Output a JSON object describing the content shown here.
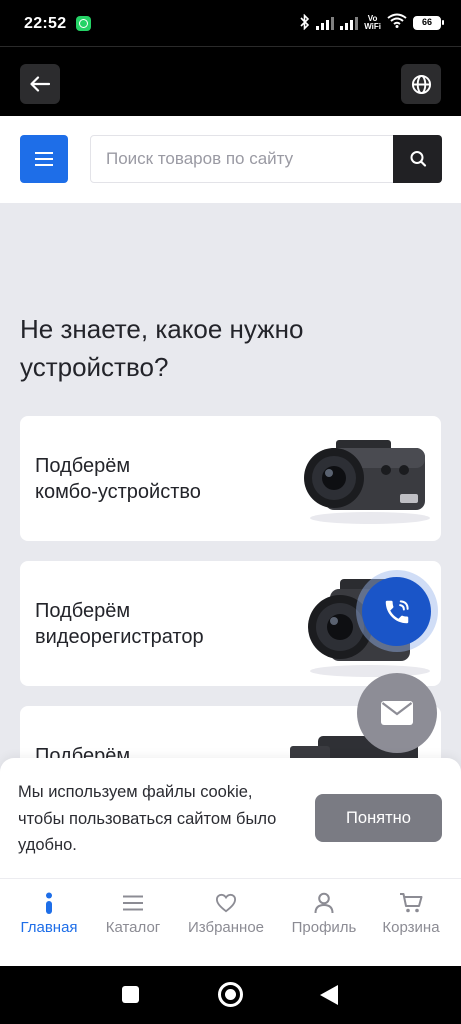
{
  "status_bar": {
    "time": "22:52",
    "network_label_top": "Vo",
    "network_label_bottom": "WiFi",
    "battery": "66"
  },
  "header": {
    "search_placeholder": "Поиск товаров по сайту"
  },
  "main": {
    "title": "Не знаете, какое нужно устройство?",
    "cards": [
      {
        "label_line1": "Подберём",
        "label_line2": "комбо-устройство"
      },
      {
        "label_line1": "Подберём",
        "label_line2": "видеорегистратор"
      },
      {
        "label_line1": "Подберём",
        "label_line2": ""
      }
    ]
  },
  "cookie_banner": {
    "text": "Мы используем файлы cookie, чтобы пользоваться сайтом было удобно.",
    "button_label": "Понятно"
  },
  "bottom_nav": {
    "items": [
      {
        "label": "Главная",
        "icon": "info-icon",
        "active": true
      },
      {
        "label": "Каталог",
        "icon": "list-icon",
        "active": false
      },
      {
        "label": "Избранное",
        "icon": "heart-icon",
        "active": false
      },
      {
        "label": "Профиль",
        "icon": "user-icon",
        "active": false
      },
      {
        "label": "Корзина",
        "icon": "cart-icon",
        "active": false
      }
    ]
  },
  "colors": {
    "accent": "#1e6ee8",
    "call_button": "#1a55c8",
    "page_background": "#e8e9ee"
  }
}
